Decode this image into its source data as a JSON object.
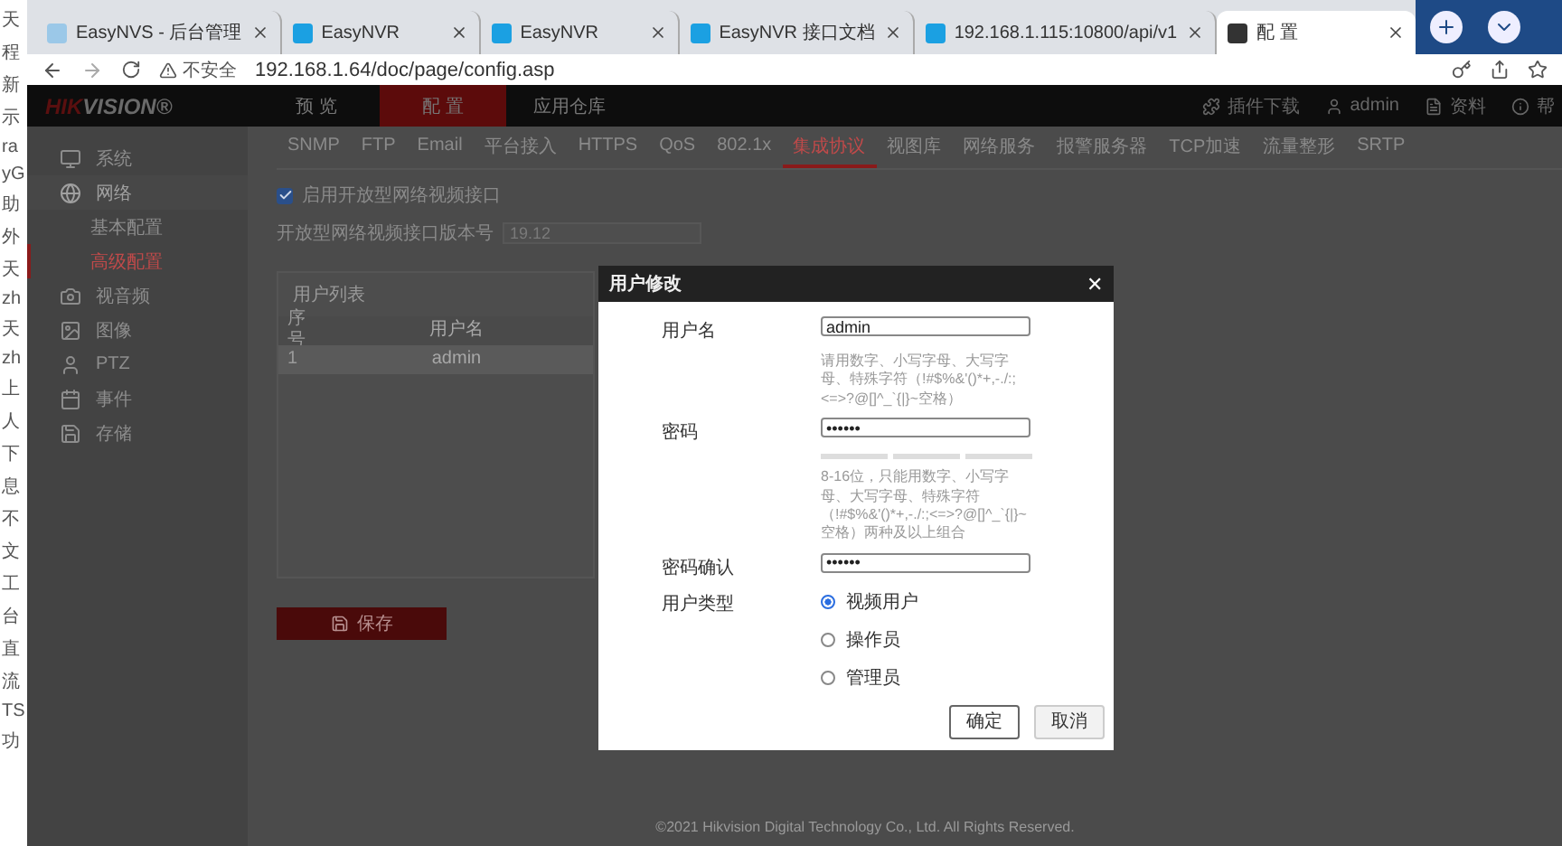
{
  "background_window": {
    "fragments": [
      "天",
      "程",
      "新",
      "示",
      "ra",
      "yG",
      "助",
      "外",
      "天",
      "zh",
      "天",
      "zh",
      "上",
      "人",
      "下",
      "息",
      "不",
      "文",
      "工",
      "台",
      "直",
      "流",
      "TS",
      "功"
    ]
  },
  "browser_tabs": [
    {
      "title": "EasyNVS - 后台管理",
      "selected": false
    },
    {
      "title": "EasyNVR",
      "selected": false
    },
    {
      "title": "EasyNVR",
      "selected": false
    },
    {
      "title": "EasyNVR 接口文档",
      "selected": false
    },
    {
      "title": "192.168.1.115:10800/api/v1",
      "selected": false
    },
    {
      "title": "配 置",
      "selected": true
    }
  ],
  "address_bar": {
    "security": "不安全",
    "url": "192.168.1.64/doc/page/config.asp"
  },
  "header": {
    "logo_red": "HIK",
    "logo_rest": "VISION®",
    "nav": [
      {
        "label": "预 览",
        "selected": false
      },
      {
        "label": "配 置",
        "selected": true
      },
      {
        "label": "应用仓库",
        "selected": false
      }
    ],
    "actions": [
      {
        "kind": "plugin",
        "label": "插件下载"
      },
      {
        "kind": "user",
        "label": "admin"
      },
      {
        "kind": "docs",
        "label": "资料"
      },
      {
        "kind": "help",
        "label": "帮"
      }
    ]
  },
  "sub_tabs": [
    {
      "label": "SNMP",
      "selected": false
    },
    {
      "label": "FTP",
      "selected": false
    },
    {
      "label": "Email",
      "selected": false
    },
    {
      "label": "平台接入",
      "selected": false
    },
    {
      "label": "HTTPS",
      "selected": false
    },
    {
      "label": "QoS",
      "selected": false
    },
    {
      "label": "802.1x",
      "selected": false
    },
    {
      "label": "集成协议",
      "selected": true
    },
    {
      "label": "视图库",
      "selected": false
    },
    {
      "label": "网络服务",
      "selected": false
    },
    {
      "label": "报警服务器",
      "selected": false
    },
    {
      "label": "TCP加速",
      "selected": false
    },
    {
      "label": "流量整形",
      "selected": false
    },
    {
      "label": "SRTP",
      "selected": false
    }
  ],
  "sidebar": {
    "items": [
      {
        "kind": "system",
        "label": "系统",
        "selected": false
      },
      {
        "kind": "network",
        "label": "网络",
        "expanded": true,
        "selected": false,
        "children": [
          {
            "label": "基本配置",
            "selected": false
          },
          {
            "label": "高级配置",
            "selected": true
          }
        ]
      },
      {
        "kind": "av",
        "label": "视音频",
        "selected": false
      },
      {
        "kind": "image",
        "label": "图像",
        "selected": false
      },
      {
        "kind": "ptz",
        "label": "PTZ",
        "selected": false
      },
      {
        "kind": "event",
        "label": "事件",
        "selected": false
      },
      {
        "kind": "storage",
        "label": "存储",
        "selected": false
      }
    ]
  },
  "settings": {
    "enable_label": "启用开放型网络视频接口",
    "enable_checked": true,
    "version_label": "开放型网络视频接口版本号",
    "version_value": "19.12"
  },
  "user_list": {
    "title": "用户列表",
    "columns": [
      "序号",
      "用户名"
    ],
    "rows": [
      {
        "cells": [
          "1",
          "admin"
        ],
        "selected": true
      }
    ]
  },
  "save_button": "保存",
  "footer": "©2021 Hikvision Digital Technology Co., Ltd. All Rights Reserved.",
  "dialog": {
    "title": "用户修改",
    "close": "✕",
    "username_label": "用户名",
    "username_value": "admin",
    "username_hint": "请用数字、小写字母、大写字母、特殊字符（!#$%&'()*+,-./:;<=>?@[]^_`{|}~空格）",
    "password_label": "密码",
    "password_value": "••••••",
    "password_hint": "8-16位，只能用数字、小写字母、大写字母、特殊字符（!#$%&'()*+,-./:;<=>?@[]^_`{|}~空格）两种及以上组合",
    "confirm_label": "密码确认",
    "confirm_value": "••••••",
    "type_label": "用户类型",
    "user_types": [
      {
        "label": "视频用户",
        "selected": true
      },
      {
        "label": "操作员",
        "selected": false
      },
      {
        "label": "管理员",
        "selected": false
      }
    ],
    "ok": "确定",
    "cancel": "取消"
  }
}
